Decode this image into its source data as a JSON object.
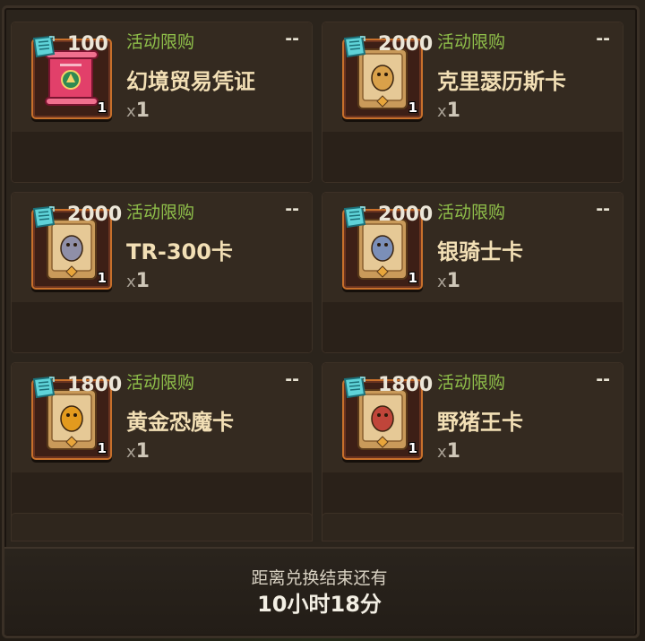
{
  "items": [
    {
      "tag": "活动限购",
      "limit": "--",
      "name": "幻境贸易凭证",
      "qty_prefix": "x",
      "qty": "1",
      "count": "1",
      "price": "100",
      "icon": "scroll-voucher-icon",
      "accent": "#e0405a"
    },
    {
      "tag": "活动限购",
      "limit": "--",
      "name": "克里瑟历斯卡",
      "qty_prefix": "x",
      "qty": "1",
      "count": "1",
      "price": "2000",
      "icon": "scorpion-card-icon",
      "accent": "#d9a14a"
    },
    {
      "tag": "活动限购",
      "limit": "--",
      "name": "TR-300卡",
      "qty_prefix": "x",
      "qty": "1",
      "count": "1",
      "price": "2000",
      "icon": "robot-card-icon",
      "accent": "#8f8fa8"
    },
    {
      "tag": "活动限购",
      "limit": "--",
      "name": "银骑士卡",
      "qty_prefix": "x",
      "qty": "1",
      "count": "1",
      "price": "2000",
      "icon": "knight-card-icon",
      "accent": "#7b8fb8"
    },
    {
      "tag": "活动限购",
      "limit": "--",
      "name": "黄金恐魔卡",
      "qty_prefix": "x",
      "qty": "1",
      "count": "1",
      "price": "1800",
      "icon": "golden-demon-card-icon",
      "accent": "#e39a1e"
    },
    {
      "tag": "活动限购",
      "limit": "--",
      "name": "野猪王卡",
      "qty_prefix": "x",
      "qty": "1",
      "count": "1",
      "price": "1800",
      "icon": "boar-king-card-icon",
      "accent": "#c0453a"
    }
  ],
  "currency_icon": "ticket-currency-icon",
  "footer": {
    "label": "距离兑换结束还有",
    "time": "10小时18分"
  },
  "colors": {
    "tag_green": "#8fbf4a",
    "name_gold": "#f2dfb5",
    "frame_orange": "#c8702b",
    "currency_cyan": "#5fd3d8"
  }
}
